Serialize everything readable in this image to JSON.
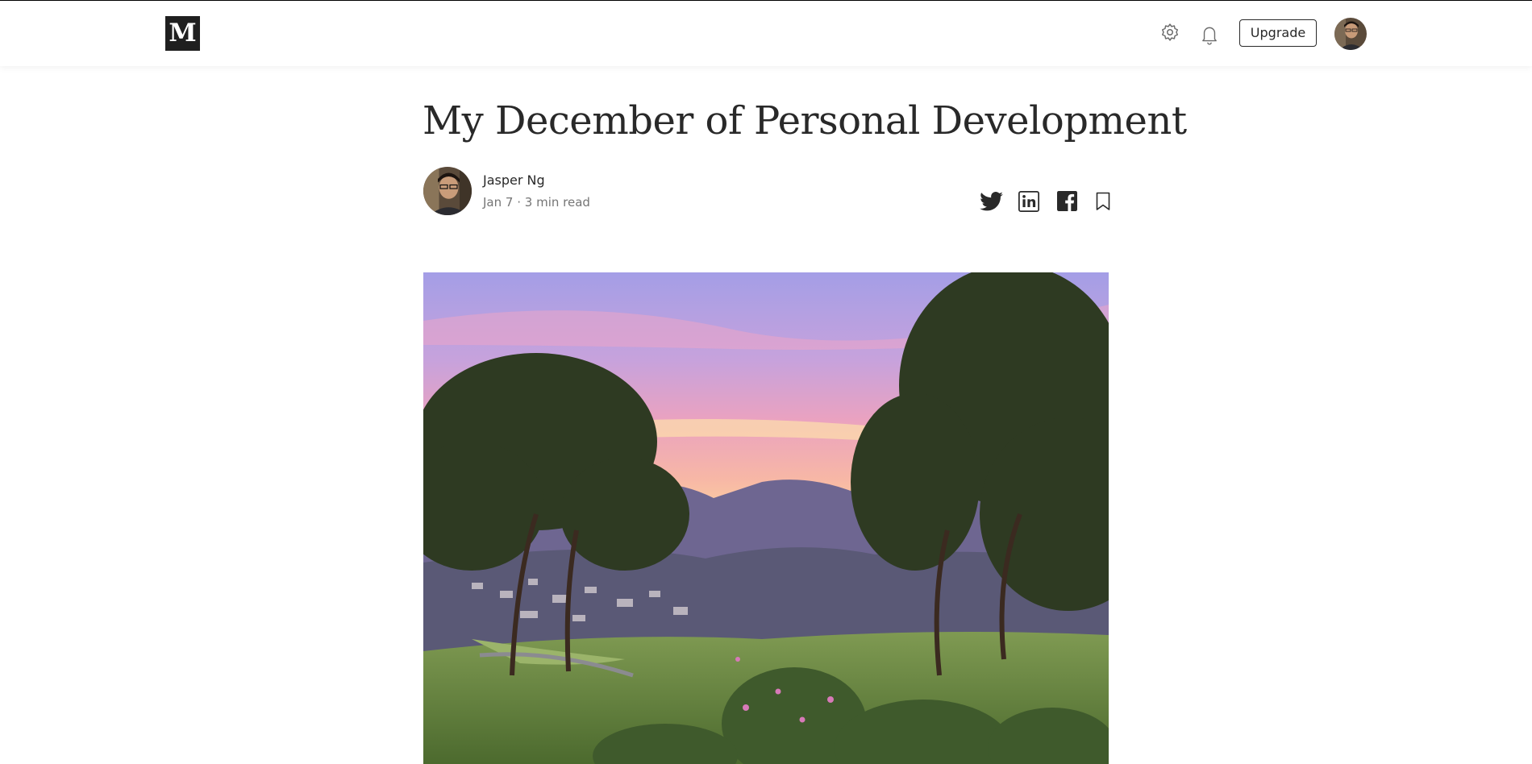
{
  "app": {
    "logo_letter": "M",
    "brand_color": "#1f1f1f"
  },
  "header": {
    "icons": [
      "gear-icon",
      "bell-icon"
    ],
    "upgrade_label": "Upgrade",
    "avatar": "user-avatar"
  },
  "article": {
    "title": "My December of Personal Development",
    "author": {
      "name": "Jasper Ng",
      "date": "Jan 7",
      "separator": "·",
      "read_time": "3 min read",
      "avatar": "author-avatar"
    },
    "share_icons": [
      "twitter-icon",
      "linkedin-icon",
      "facebook-icon",
      "bookmark-icon"
    ],
    "hero_image": "sunset-valley-photo"
  },
  "colors": {
    "text_primary": "#292929",
    "text_secondary": "#757575",
    "background": "#ffffff"
  }
}
